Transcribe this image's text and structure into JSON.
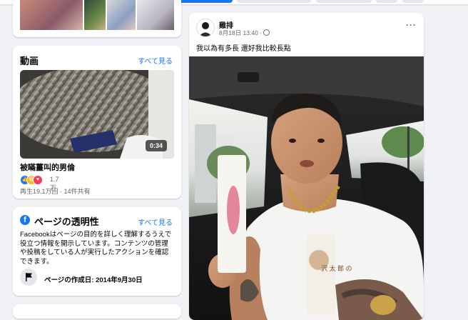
{
  "videos_section": {
    "title": "動画",
    "see_all": "すべて見る",
    "video": {
      "duration": "0:34",
      "title": "被瞞薑叫的男倫",
      "reaction_count": "1.7万",
      "meta": "再生19.1万回 · 14件共有"
    }
  },
  "transparency_section": {
    "title": "ページの透明性",
    "see_all": "すべて見る",
    "description": "Facebookはページの目的を詳しく理解するうえで役立つ情報を開示しています。コンテンツの管理や投稿をしている人が実行したアクションを確認できます。",
    "created_label": "ページの作成日: 2014年9月30日"
  },
  "post": {
    "author": "雞排",
    "date": "8月18日 13:40 ·",
    "more": "···",
    "text": "我以為有多長 還好我比較長點",
    "bag_text": "沢 太 郎 の"
  },
  "colors": {
    "accent": "#1877f2",
    "page_bg": "#f0f2f5",
    "secondary_text": "#65676b"
  }
}
